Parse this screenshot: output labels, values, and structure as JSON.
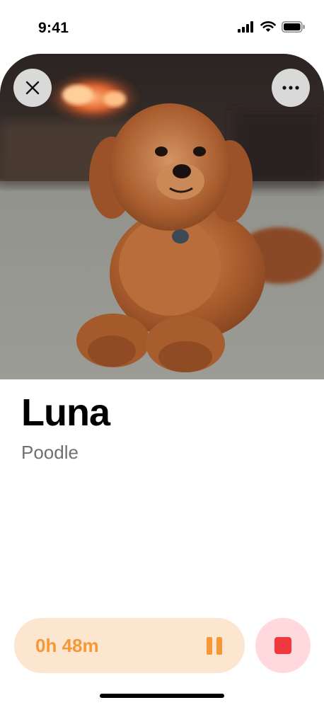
{
  "status_bar": {
    "time": "9:41",
    "icons": [
      "cellular-signal-icon",
      "wifi-icon",
      "battery-icon"
    ]
  },
  "photo": {
    "description_icon": "dog-photo",
    "close_icon": "close-icon",
    "more_icon": "more-options-icon"
  },
  "pet": {
    "name": "Luna",
    "breed": "Poodle"
  },
  "session": {
    "elapsed": "0h 48m",
    "pause_icon": "pause-icon",
    "stop_icon": "stop-icon"
  },
  "colors": {
    "accent_orange": "#f59838",
    "timer_bg": "#fde6cf",
    "stop_red": "#f0383f",
    "stop_bg": "#ffd9db",
    "secondary_text": "#707070"
  }
}
